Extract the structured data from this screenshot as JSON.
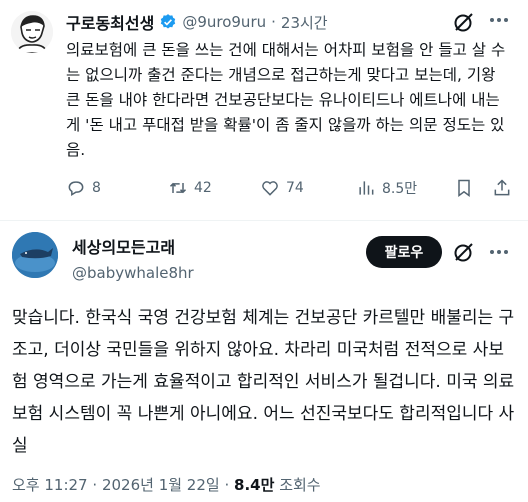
{
  "tweet1": {
    "display_name": "구로동최선생",
    "handle": "@9uro9uru",
    "separator": "·",
    "time": "23시간",
    "text": "의료보험에 큰 돈을 쓰는 건에 대해서는 어차피 보험을 안 들고 살 수는 없으니까 출건 준다는 개념으로 접근하는게 맞다고 보는데, 기왕 큰 돈을 내야 한다라면 건보공단보다는 유나이티드나 에트나에 내는게 '돈 내고 푸대접 받을 확률'이 좀 줄지 않을까 하는 의문 정도는 있음.",
    "replies": "8",
    "retweets": "42",
    "likes": "74",
    "views": "8.5만",
    "icons": [
      "verified-badge-icon",
      "grok-icon",
      "reply-icon",
      "retweet-icon",
      "like-icon",
      "views-icon",
      "bookmark-icon"
    ],
    "verified_color": "#1d9bf0"
  },
  "tweet2": {
    "display_name": "세상의모든고래",
    "handle": "@babywhale8hr",
    "follow_label": "팔로우",
    "avatar_text": "세상의 모든 고래",
    "text": "맞습니다. 한국식 국영 건강보험 체계는 건보공단 카르텔만 배불리는 구조고, 더이상 국민들을 위하지 않아요. 차라리 미국처럼 전적으로 사보험 영역으로 가는게 효율적이고 합리적인 서비스가 될겁니다. 미국 의료보험 시스템이 꼭 나쁜게 아니에요. 어느 선진국보다도 합리적입니다 사실",
    "time": "오후 11:27",
    "separator": "·",
    "date": "2026년 1월 22일",
    "views_count": "8.4만",
    "views_label": "조회수"
  }
}
